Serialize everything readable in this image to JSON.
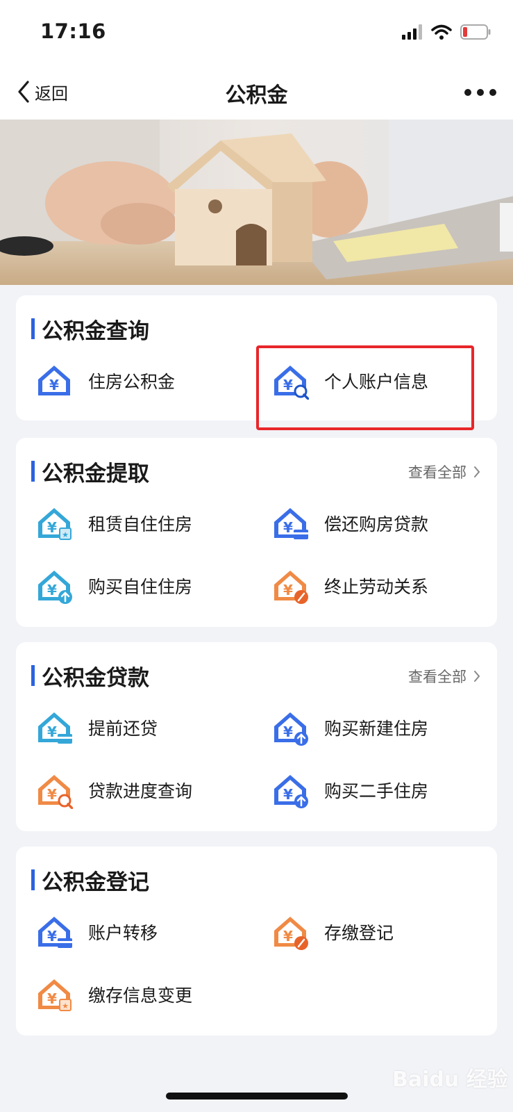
{
  "status_bar": {
    "time": "17:16"
  },
  "nav": {
    "back_label": "返回",
    "title": "公积金"
  },
  "sections": [
    {
      "title": "公积金查询",
      "view_all": "",
      "items": [
        {
          "label": "住房公积金",
          "icon": "house-yuan-icon",
          "color": "#3a6ee8"
        },
        {
          "label": "个人账户信息",
          "icon": "house-yuan-search-icon",
          "color": "#3a6ee8"
        }
      ]
    },
    {
      "title": "公积金提取",
      "view_all": "查看全部",
      "items": [
        {
          "label": "租赁自住住房",
          "icon": "house-yuan-star-icon",
          "color": "#34a7d8"
        },
        {
          "label": "偿还购房贷款",
          "icon": "house-yuan-card-icon",
          "color": "#3a6ee8"
        },
        {
          "label": "购买自住住房",
          "icon": "house-yuan-up-icon",
          "color": "#34a7d8"
        },
        {
          "label": "终止劳动关系",
          "icon": "house-yuan-pen-icon",
          "color": "#f08a45"
        }
      ]
    },
    {
      "title": "公积金贷款",
      "view_all": "查看全部",
      "items": [
        {
          "label": "提前还贷",
          "icon": "house-yuan-card-icon",
          "color": "#34a7d8"
        },
        {
          "label": "购买新建住房",
          "icon": "house-yuan-up-icon",
          "color": "#3a6ee8"
        },
        {
          "label": "贷款进度查询",
          "icon": "house-yuan-search-icon",
          "color": "#f08a45"
        },
        {
          "label": "购买二手住房",
          "icon": "house-yuan-up-icon",
          "color": "#3a6ee8"
        }
      ]
    },
    {
      "title": "公积金登记",
      "view_all": "",
      "items": [
        {
          "label": "账户转移",
          "icon": "house-yuan-card-icon",
          "color": "#3a6ee8"
        },
        {
          "label": "存缴登记",
          "icon": "house-yuan-pen-icon",
          "color": "#f08a45"
        },
        {
          "label": "缴存信息变更",
          "icon": "house-yuan-star-icon",
          "color": "#f08a45"
        }
      ]
    }
  ],
  "watermark": "Baidu 经验"
}
